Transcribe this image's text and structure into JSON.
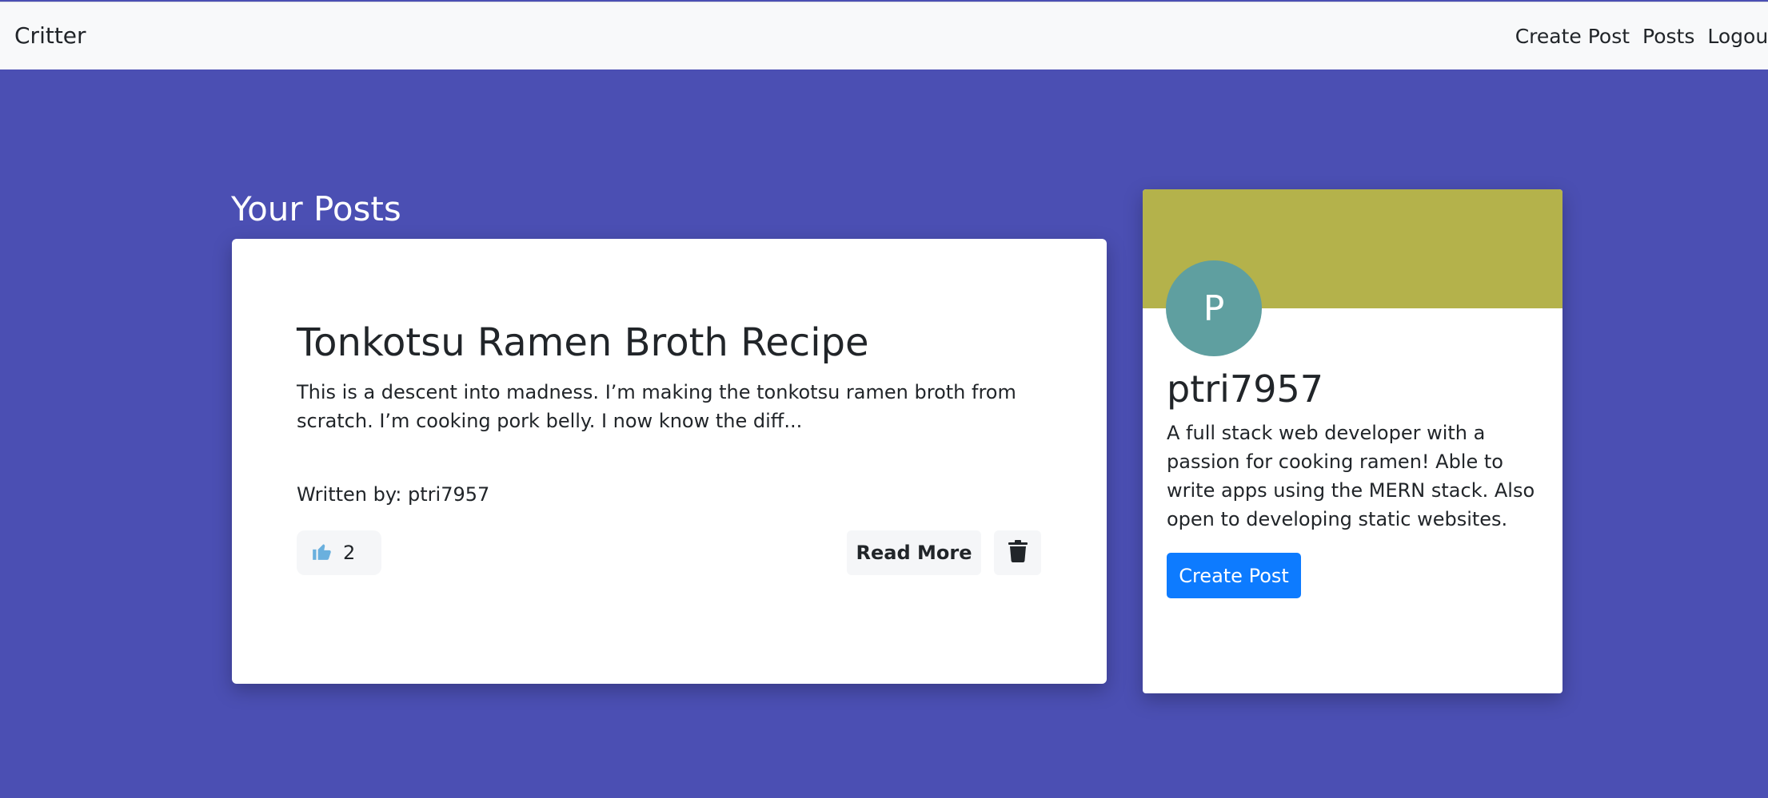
{
  "navbar": {
    "brand": "Critter",
    "links": [
      "Create Post",
      "Posts",
      "Logout"
    ]
  },
  "main": {
    "section_title": "Your Posts",
    "post": {
      "title": "Tonkotsu Ramen Broth Recipe",
      "excerpt": "This is a descent into madness. I’m making the tonkotsu ramen broth from scratch. I’m cooking pork belly. I now know the diff...",
      "author": "Written by: ptri7957",
      "likes": "2",
      "read_more_label": "Read More",
      "icons": {
        "like": "thumbs-up-icon",
        "delete": "trash-icon"
      }
    }
  },
  "profile": {
    "avatar_initial": "P",
    "username": "ptri7957",
    "bio": "A full stack web developer with a passion for cooking ramen! Able to write apps using the MERN stack. Also open to developing static websites.",
    "create_post_label": "Create Post"
  },
  "colors": {
    "page_background": "#4b4fb3",
    "banner": "#b4b24b",
    "avatar": "#5f9fa0",
    "primary_button": "#0d7bff",
    "like_icon": "#6ab0de"
  }
}
